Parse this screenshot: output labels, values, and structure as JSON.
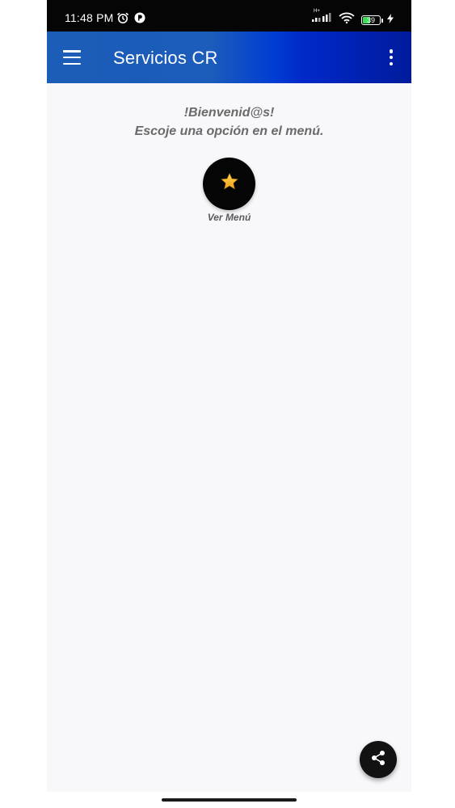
{
  "status_bar": {
    "time": "11:48 PM",
    "left_icons": [
      "alarm-icon",
      "app-notification-icon"
    ],
    "right_icons": [
      "signal-icon",
      "wifi-icon",
      "battery-icon",
      "charging-icon"
    ],
    "signal_tag": "H+",
    "battery_level": "39"
  },
  "app_bar": {
    "title": "Servicios CR",
    "menu_icon": "hamburger-menu-icon",
    "overflow_icon": "more-vert-icon",
    "colors": {
      "start": "#1c5db8",
      "end": "#001b9c"
    }
  },
  "content": {
    "welcome_line1": "!Bienvenid@s!",
    "welcome_line2": "Escoje una opción en el menú.",
    "menu_button": {
      "icon": "star-icon",
      "label": "Ver Menú"
    }
  },
  "share_button": {
    "icon": "share-icon"
  },
  "colors": {
    "status_bar": "#050505",
    "background": "#f8f8fb",
    "text_secondary": "#6a6a6a",
    "star": "#f7b928",
    "fab": "#121212"
  }
}
